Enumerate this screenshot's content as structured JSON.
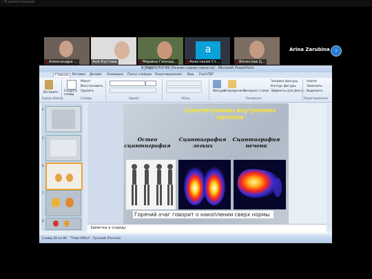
{
  "meeting": {
    "top_left_label": "• В демонстрации",
    "participants": [
      {
        "name": "Александра ...",
        "muted": true
      },
      {
        "name": "Аня Кустова",
        "muted": false
      },
      {
        "name": "Марина Геннад...",
        "muted": true
      },
      {
        "name": "Анастасия Ст...",
        "muted": true,
        "avatar_letter": "a"
      },
      {
        "name": "Вячеслав Ц...",
        "muted": true
      },
      {
        "name": "Arina Zarubina",
        "muted": false
      }
    ],
    "next_arrow": "›"
  },
  "ppt": {
    "window_title": "8_РАДИОЛОГИЯ [Режим совместимости] - Microsoft PowerPoint",
    "window_buttons": "– ❐ ✕",
    "tabs": [
      "Главная",
      "Вставка",
      "Дизайн",
      "Анимация",
      "Показ слайдов",
      "Рецензирование",
      "Вид",
      "Foxit PDF"
    ],
    "ribbon": {
      "paste": "Вставить",
      "create_slide": "Создать слайд",
      "layout": "Макет",
      "restore": "Восстановить",
      "delete": "Удалить",
      "find": "Найти",
      "replace": "Заменить",
      "select": "Выделить",
      "figures": "Фигуры",
      "arrange": "Упорядочить",
      "quick_styles": "Экспресс-стили",
      "shape_fill": "Заливка фигуры",
      "shape_outline": "Контур фигуры",
      "shape_effects": "Эффекты для фигур",
      "groups": [
        "Буфер обмена",
        "Слайды",
        "Шрифт",
        "Абзац",
        "Рисование",
        "Редактирование"
      ]
    },
    "slide_numbers": [
      "4",
      "5",
      "6",
      "7",
      "8"
    ],
    "slide": {
      "title": "Сцинтиграммы внутренних органов",
      "columns": [
        "Остео сцинтиграфия",
        "Сцинтиграфия легких",
        "Сцинтиграфия печени"
      ],
      "caption": "Горячий очаг говорит о накоплении сверх нормы"
    },
    "notes_placeholder": "Заметки к слайду",
    "status": {
      "slide_counter": "Слайд 30 из 46",
      "theme": "\"Тема Office\"",
      "language": "Русский (Россия)"
    }
  },
  "colors": {
    "ribbon_bg": "#dbe6f4",
    "title_yellow": "#f7e23a",
    "mute_red": "#e33333",
    "zoom_blue": "#2a7bd6"
  }
}
